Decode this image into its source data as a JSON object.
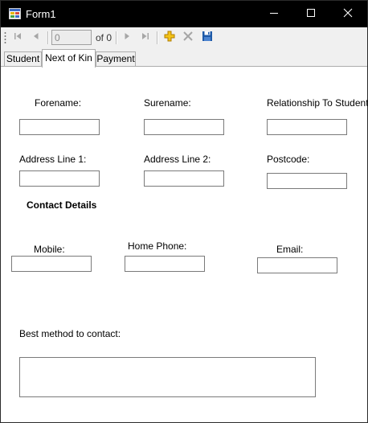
{
  "window": {
    "title": "Form1"
  },
  "toolbar": {
    "position_value": "0",
    "count_label": "of 0"
  },
  "tabs": [
    {
      "label": "Student",
      "active": false
    },
    {
      "label": "Next of Kin",
      "active": true
    },
    {
      "label": "Payment",
      "active": false
    }
  ],
  "form": {
    "forename_label": "Forename:",
    "surname_label": "Surename:",
    "relationship_label": "Relationship To Student:",
    "address1_label": "Address Line 1:",
    "address2_label": "Address Line 2:",
    "postcode_label": "Postcode:",
    "contact_heading": "Contact Details",
    "mobile_label": "Mobile:",
    "home_phone_label": "Home Phone:",
    "email_label": "Email:",
    "best_method_label": "Best method to contact:",
    "forename_value": "",
    "surname_value": "",
    "relationship_value": "",
    "address1_value": "",
    "address2_value": "",
    "postcode_value": "",
    "mobile_value": "",
    "home_phone_value": "",
    "email_value": "",
    "best_method_value": ""
  },
  "colors": {
    "titlebar": "#000000",
    "toolbar": "#f0f0f0",
    "add_icon": "#e8b400",
    "save_icon": "#1e5aa8"
  },
  "icons": {
    "app": "app-form-icon",
    "minimize": "minimize-icon",
    "maximize": "maximize-icon",
    "close": "close-icon",
    "first": "move-first-icon",
    "previous": "move-previous-icon",
    "next": "move-next-icon",
    "last": "move-last-icon",
    "add": "add-new-icon",
    "delete": "delete-icon",
    "save": "save-icon"
  }
}
